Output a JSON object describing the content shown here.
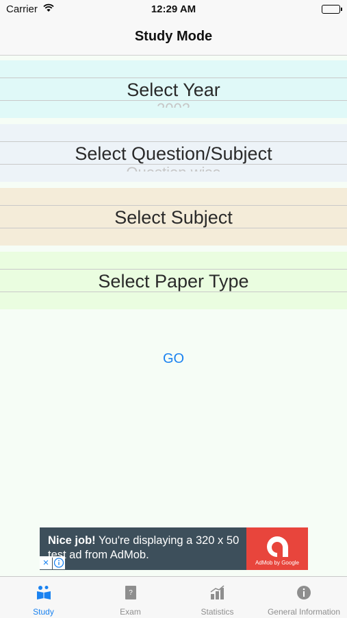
{
  "status_bar": {
    "carrier": "Carrier",
    "time": "12:29 AM"
  },
  "nav": {
    "title": "Study Mode"
  },
  "pickers": {
    "year": {
      "label": "Select Year",
      "next_value": "2002"
    },
    "question": {
      "label": "Select Question/Subject",
      "next_value": "Question wise"
    },
    "subject": {
      "label": "Select Subject"
    },
    "paper_type": {
      "label": "Select Paper Type"
    }
  },
  "go_label": "GO",
  "ad": {
    "bold_text": "Nice job!",
    "text": " You're displaying a 320 x 50 test ad from AdMob.",
    "logo_text": "AdMob by Google",
    "brand_color": "#e8453c"
  },
  "tabs": [
    {
      "label": "Study",
      "icon": "study-icon",
      "active": true
    },
    {
      "label": "Exam",
      "icon": "exam-icon",
      "active": false
    },
    {
      "label": "Statistics",
      "icon": "statistics-icon",
      "active": false
    },
    {
      "label": "General Information",
      "icon": "info-icon",
      "active": false
    }
  ],
  "colors": {
    "accent": "#1a82f0"
  }
}
